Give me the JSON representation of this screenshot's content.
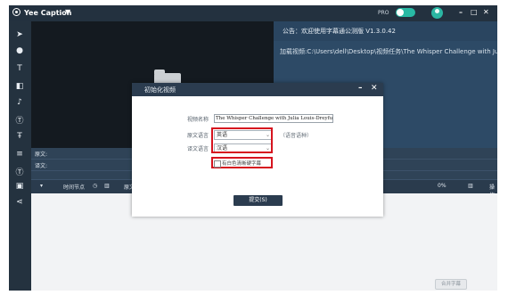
{
  "app": {
    "title": "Yee Caption",
    "pro_label": "PRO",
    "window_controls": {
      "minimize": "–",
      "maximize": "□",
      "close": "✕"
    }
  },
  "toolbar": {
    "icons": [
      "cursor-icon",
      "mic-icon",
      "text-icon",
      "crop-icon",
      "voice-icon",
      "caption-icon",
      "text-format-icon",
      "translate-icon",
      "subtitle-icon",
      "save-icon",
      "share-icon"
    ]
  },
  "notice": {
    "text": "公告：欢迎使用字幕通公测版 V1.3.0.42"
  },
  "load_path": "加载视频:C:\\Users\\dell\\Desktop\\视频任务\\The Whisper Challenge with Julia Louis-D",
  "rows": {
    "source_label": "原文:",
    "translation_label": "译文:"
  },
  "list_header": {
    "time_node": "时间节点",
    "source": "原文（",
    "progress": "0%",
    "operation": "操作"
  },
  "merge_button": "合并字幕",
  "dialog": {
    "title": "初始化视频",
    "minimize": "–",
    "close": "✕",
    "name_label": "视频名称",
    "name_value": "The Whisper Challenge with Julia Louis-Dreyfus",
    "source_lang_label": "原文语言",
    "source_lang_value": "英语",
    "source_lang_hint": "（语音语种）",
    "target_lang_label": "译文语言",
    "target_lang_value": "汉语",
    "checkbox_label": "有白色清晰硬字幕",
    "checkbox_checked": false,
    "submit_label": "提交(S)"
  },
  "colors": {
    "accent": "#28b9a4",
    "panel": "#2b3c4f",
    "highlight": "#d6141f"
  }
}
